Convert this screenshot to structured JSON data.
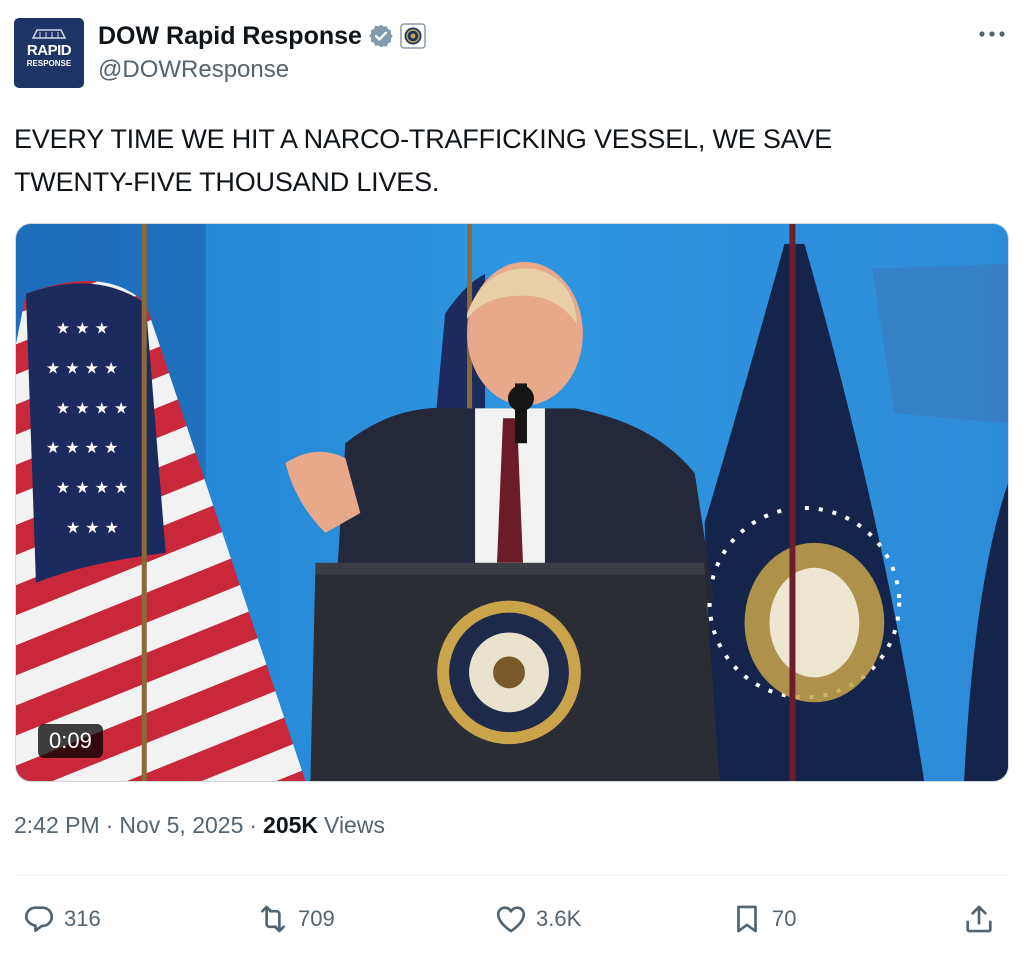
{
  "author": {
    "display_name": "DOW Rapid Response",
    "handle": "@DOWResponse",
    "avatar_text_line1": "RAPID",
    "avatar_text_line2": "RESPONSE",
    "verified": true
  },
  "icons": {
    "verified": "verified-badge-icon",
    "affiliation": "affiliation-seal-icon",
    "more": "more-dots-icon",
    "reply": "reply-icon",
    "retweet": "retweet-icon",
    "like": "heart-icon",
    "bookmark": "bookmark-icon",
    "share": "share-icon"
  },
  "tweet": {
    "text_line1": "EVERY TIME WE HIT A NARCO-TRAFFICKING VESSEL, WE SAVE",
    "text_line2": "TWENTY-FIVE THOUSAND LIVES."
  },
  "media": {
    "type": "video",
    "duration": "0:09"
  },
  "meta": {
    "time": "2:42 PM",
    "separator": "·",
    "date": "Nov 5, 2025",
    "views_count": "205K",
    "views_label": "Views"
  },
  "actions": {
    "replies": "316",
    "reposts": "709",
    "likes": "3.6K",
    "bookmarks": "70"
  },
  "colors": {
    "text_primary": "#0f1419",
    "text_secondary": "#536471",
    "verified_badge": "#829aab",
    "avatar_bg": "#1d3566",
    "video_bg": "#2f8fdc"
  }
}
